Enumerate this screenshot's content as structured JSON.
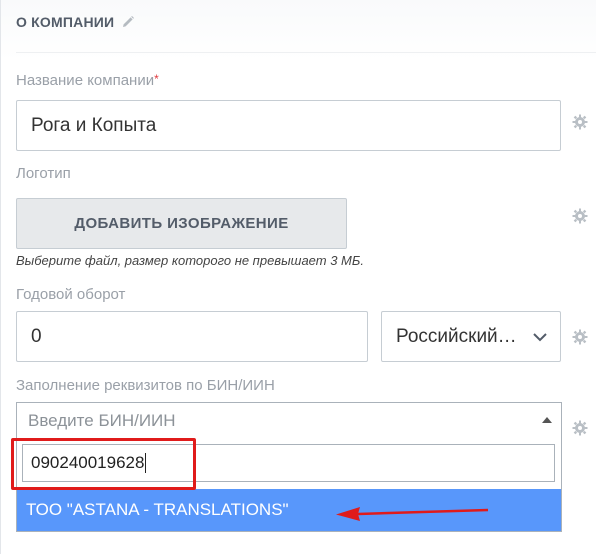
{
  "section": {
    "title": "О КОМПАНИИ"
  },
  "company_name": {
    "label": "Название компании",
    "required_mark": "*",
    "value": "Рога и Копыта"
  },
  "logo": {
    "label": "Логотип",
    "button": "ДОБАВИТЬ ИЗОБРАЖЕНИЕ",
    "hint": "Выберите файл, размер которого не превышает 3 МБ."
  },
  "revenue": {
    "label": "Годовой оборот",
    "value": "0",
    "currency": "Российский…"
  },
  "bin": {
    "label": "Заполнение реквизитов по БИН/ИИН",
    "placeholder": "Введите БИН/ИИН",
    "search_value": "090240019628",
    "option": "ТОО \"ASTANA - TRANSLATIONS\""
  },
  "colors": {
    "accent": "#5897fb",
    "annotation": "#e01b1b"
  }
}
